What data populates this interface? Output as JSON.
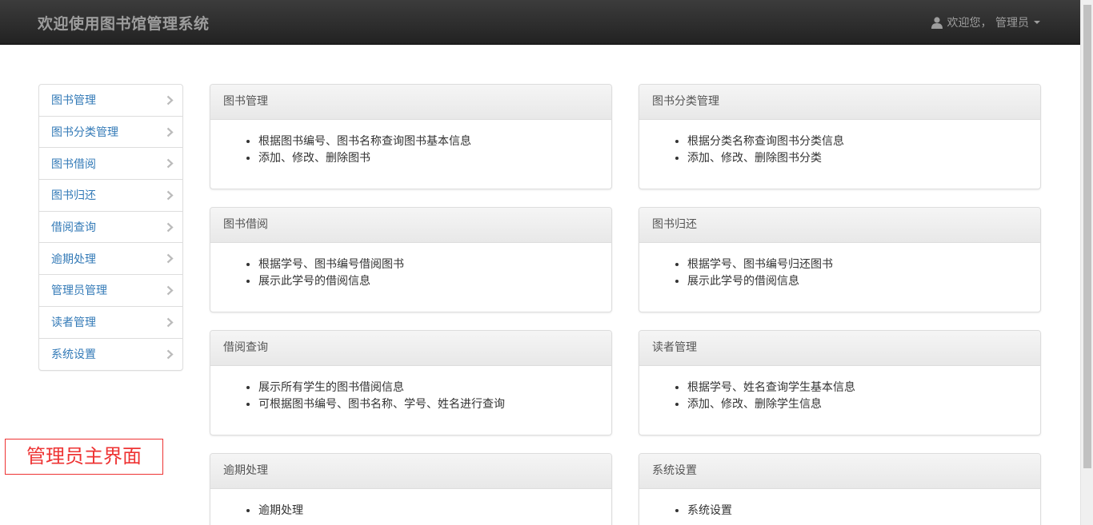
{
  "navbar": {
    "brand": "欢迎使用图书馆管理系统",
    "user_menu": "欢迎您， 管理员",
    "user_icon": "user-icon",
    "caret_icon": "caret-down-icon"
  },
  "sidebar": {
    "items": [
      {
        "label": "图书管理"
      },
      {
        "label": "图书分类管理"
      },
      {
        "label": "图书借阅"
      },
      {
        "label": "图书归还"
      },
      {
        "label": "借阅查询"
      },
      {
        "label": "逾期处理"
      },
      {
        "label": "管理员管理"
      },
      {
        "label": "读者管理"
      },
      {
        "label": "系统设置"
      }
    ],
    "chevron_icon": "chevron-right-icon"
  },
  "panels": [
    {
      "title": "图书管理",
      "items": [
        "根据图书编号、图书名称查询图书基本信息",
        "添加、修改、删除图书"
      ]
    },
    {
      "title": "图书分类管理",
      "items": [
        "根据分类名称查询图书分类信息",
        "添加、修改、删除图书分类"
      ]
    },
    {
      "title": "图书借阅",
      "items": [
        "根据学号、图书编号借阅图书",
        "展示此学号的借阅信息"
      ]
    },
    {
      "title": "图书归还",
      "items": [
        "根据学号、图书编号归还图书",
        "展示此学号的借阅信息"
      ]
    },
    {
      "title": "借阅查询",
      "items": [
        "展示所有学生的图书借阅信息",
        "可根据图书编号、图书名称、学号、姓名进行查询"
      ]
    },
    {
      "title": "读者管理",
      "items": [
        "根据学号、姓名查询学生基本信息",
        "添加、修改、删除学生信息"
      ]
    },
    {
      "title": "逾期处理",
      "items": [
        "逾期处理"
      ]
    },
    {
      "title": "系统设置",
      "items": [
        "系统设置"
      ]
    }
  ],
  "caption": "管理员主界面",
  "colors": {
    "navbar_bg": "#222222",
    "link": "#337ab7",
    "caption_border": "#ee3333"
  }
}
